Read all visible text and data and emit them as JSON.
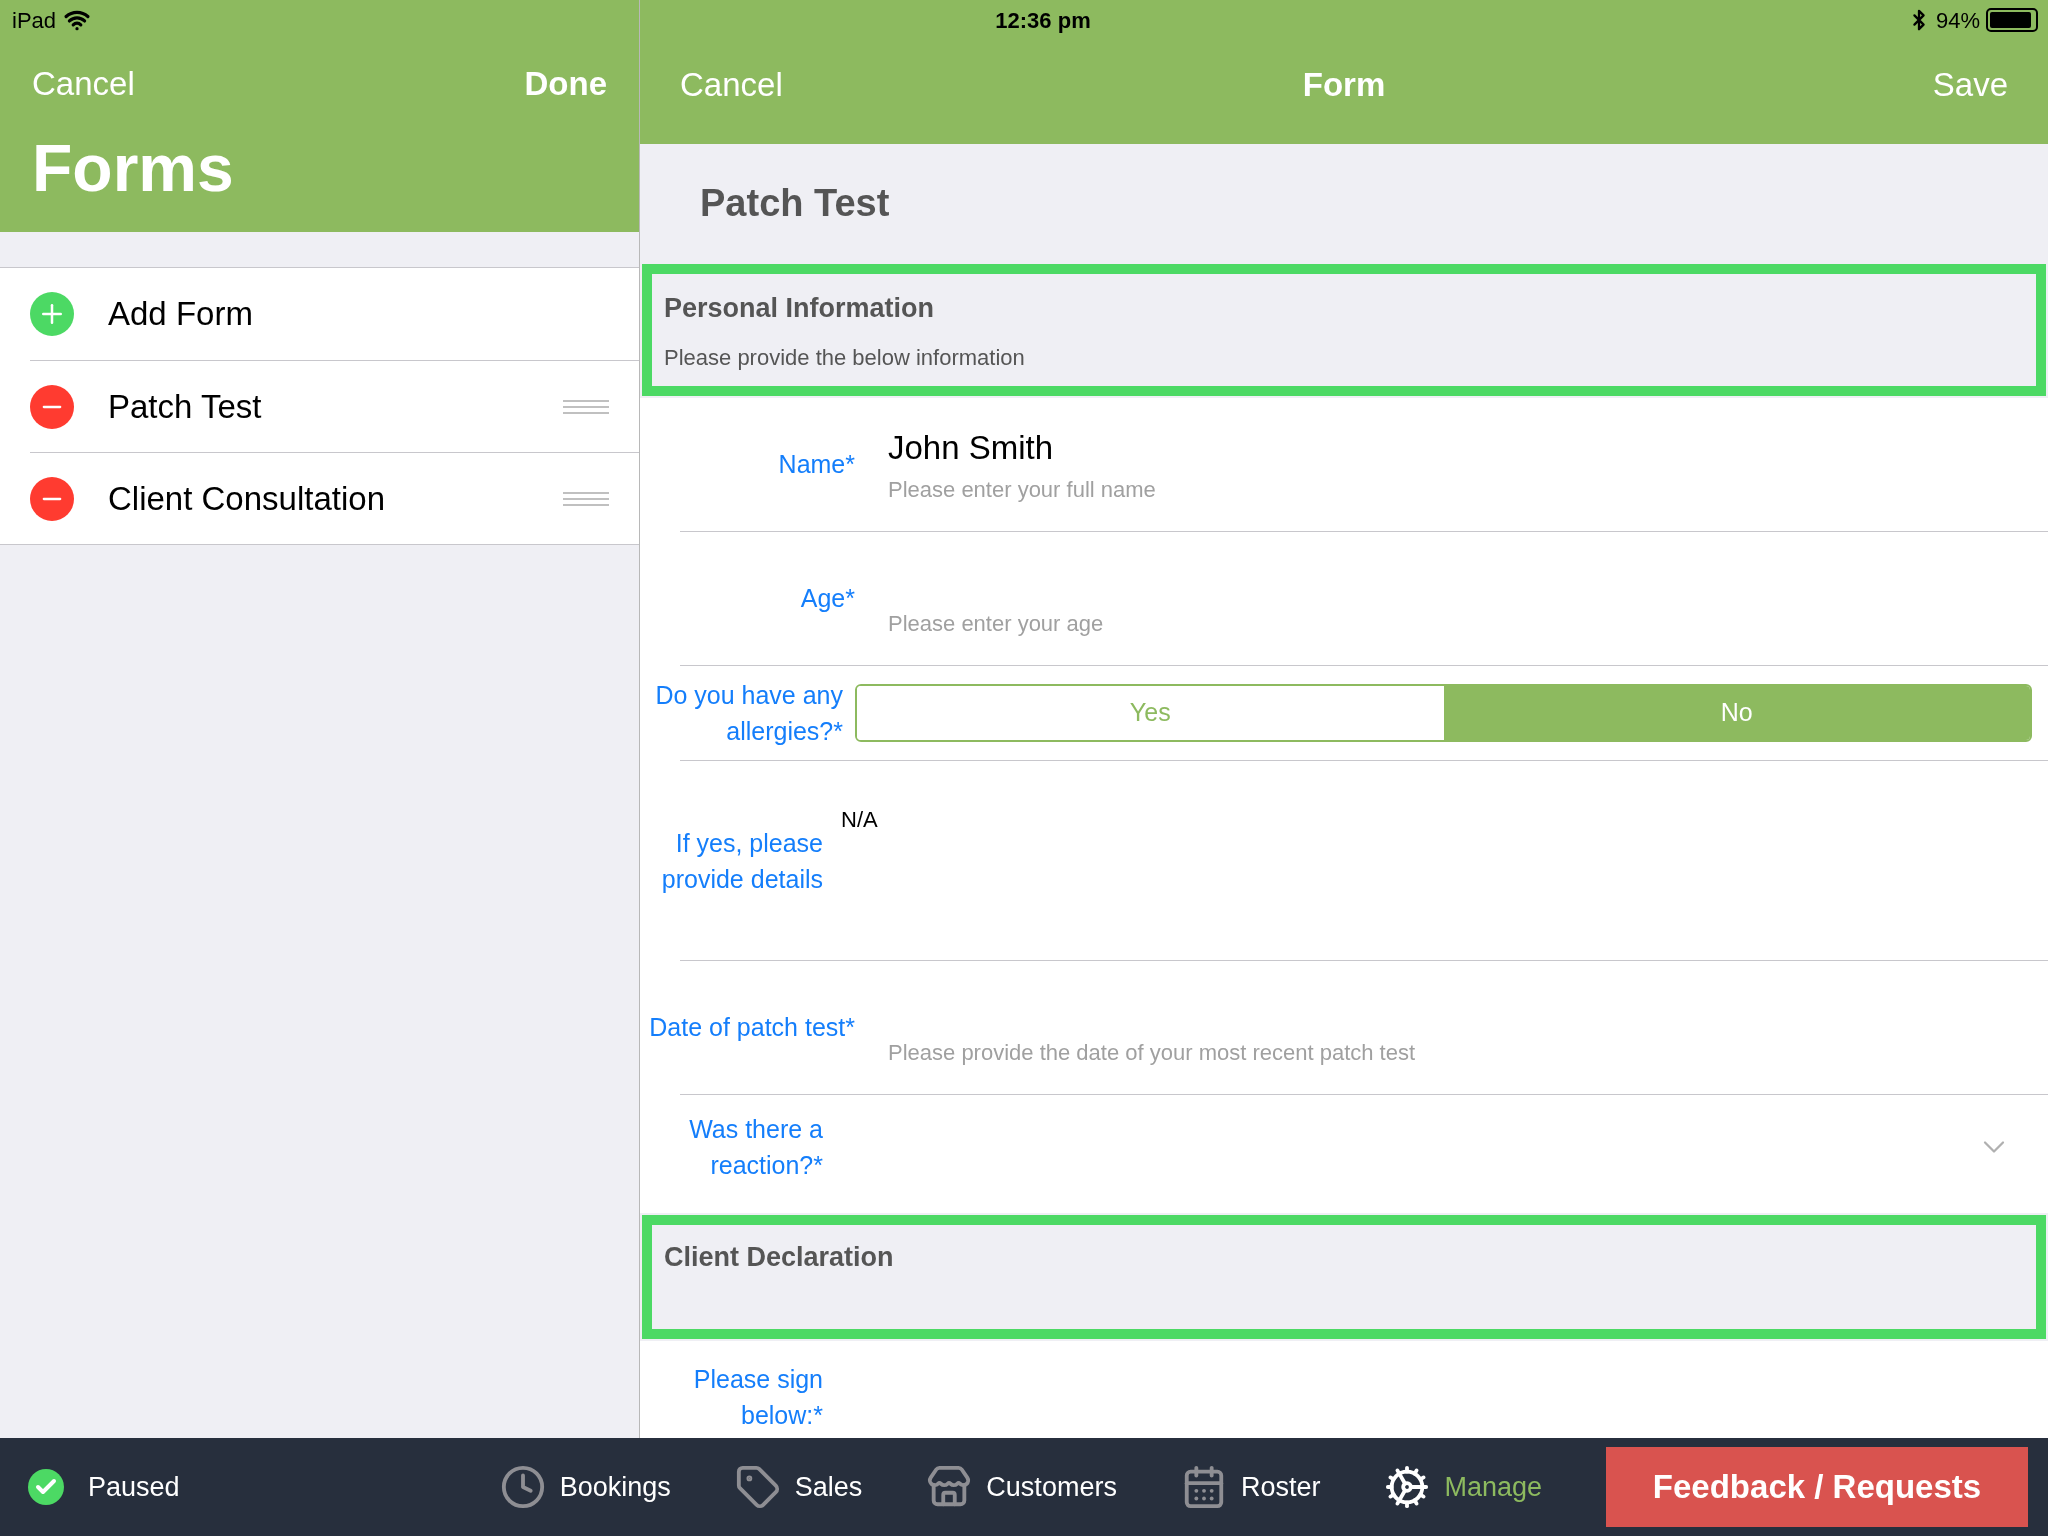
{
  "status_bar": {
    "device": "iPad",
    "time": "12:36 pm",
    "battery": "94%",
    "battery_meter": {
      "level": 0.94
    }
  },
  "forms_panel": {
    "cancel": "Cancel",
    "done": "Done",
    "title": "Forms",
    "items": [
      {
        "kind": "add",
        "label": "Add Form"
      },
      {
        "kind": "remove",
        "label": "Patch Test"
      },
      {
        "kind": "remove",
        "label": "Client Consultation"
      }
    ]
  },
  "form_panel": {
    "cancel": "Cancel",
    "title": "Form",
    "save": "Save",
    "form_title": "Patch Test",
    "rows": [
      {
        "kind": "section",
        "title": "Personal Information",
        "subtitle": "Please provide the below information",
        "highlighted": true
      },
      {
        "kind": "text",
        "label": "Name*",
        "value": "John Smith",
        "placeholder": "Please enter your full name"
      },
      {
        "kind": "text",
        "label": "Age*",
        "placeholder": "Please enter your age"
      },
      {
        "kind": "segmented",
        "label": "Do you have any allergies?*",
        "options": [
          {
            "label": "Yes",
            "selected": false
          },
          {
            "label": "No",
            "selected": true
          }
        ]
      },
      {
        "kind": "textarea",
        "label": "If yes, please provide details",
        "value": "N/A"
      },
      {
        "kind": "text",
        "label": "Date of patch test*",
        "placeholder": "Please provide the date of your most recent patch test"
      },
      {
        "kind": "dropdown",
        "label": "Was there a reaction?*"
      },
      {
        "kind": "section",
        "title": "Client Declaration",
        "highlighted": true
      },
      {
        "kind": "signature",
        "label": "Please sign below:*"
      }
    ]
  },
  "bottom_bar": {
    "status": "Paused",
    "nav": [
      {
        "label": "Bookings",
        "selected": false
      },
      {
        "label": "Sales",
        "selected": false
      },
      {
        "label": "Customers",
        "selected": false
      },
      {
        "label": "Roster",
        "selected": false
      },
      {
        "label": "Manage",
        "selected": true
      }
    ],
    "feedback": "Feedback / Requests"
  }
}
